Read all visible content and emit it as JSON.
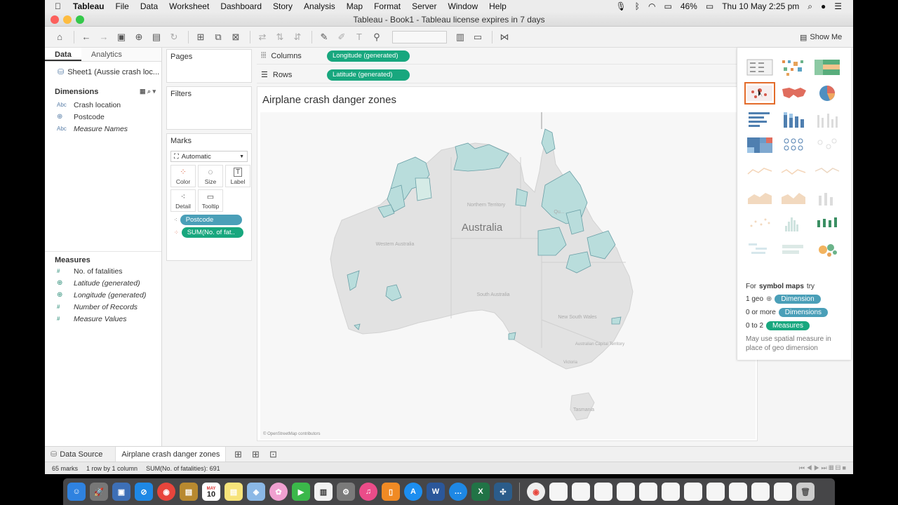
{
  "menubar": {
    "app": "Tableau",
    "items": [
      "File",
      "Data",
      "Worksheet",
      "Dashboard",
      "Story",
      "Analysis",
      "Map",
      "Format",
      "Server",
      "Window",
      "Help"
    ],
    "battery": "46%",
    "datetime": "Thu 10 May  2:25 pm"
  },
  "window": {
    "title": "Tableau - Book1 - Tableau license expires in 7 days"
  },
  "toolbar": {
    "show_me": "Show Me"
  },
  "datapane": {
    "tab_data": "Data",
    "tab_analytics": "Analytics",
    "source": "Sheet1 (Aussie crash loc...",
    "dimensions_header": "Dimensions",
    "dimensions": [
      {
        "type": "Abc",
        "label": "Crash location",
        "italic": false
      },
      {
        "type": "geo",
        "label": "Postcode",
        "italic": false
      },
      {
        "type": "Abc",
        "label": "Measure Names",
        "italic": true
      }
    ],
    "measures_header": "Measures",
    "measures": [
      {
        "type": "#",
        "label": "No. of fatalities",
        "italic": false
      },
      {
        "type": "geo",
        "label": "Latitude (generated)",
        "italic": true
      },
      {
        "type": "geo",
        "label": "Longitude (generated)",
        "italic": true
      },
      {
        "type": "#",
        "label": "Number of Records",
        "italic": true
      },
      {
        "type": "#",
        "label": "Measure Values",
        "italic": true
      }
    ]
  },
  "shelves": {
    "pages": "Pages",
    "filters": "Filters",
    "marks": "Marks",
    "mark_type": "Automatic",
    "buttons": [
      "Color",
      "Size",
      "Label",
      "Detail",
      "Tooltip"
    ],
    "pills": [
      {
        "label": "Postcode",
        "color": "#4a9fb8"
      },
      {
        "label": "SUM(No. of fat..",
        "color": "#18a77e"
      }
    ]
  },
  "columns": {
    "label": "Columns",
    "pill": "Longitude (generated)"
  },
  "rows": {
    "label": "Rows",
    "pill": "Latitude (generated)"
  },
  "view": {
    "title": "Airplane crash danger zones",
    "map_labels": {
      "country": "Australia",
      "wa": "Western Australia",
      "nt": "Northern Territory",
      "sa": "South Australia",
      "nsw": "New South Wales",
      "qld": "Qu...",
      "act": "Australian Capital Territory",
      "vic": "Victoria",
      "tas": "Tasmania"
    },
    "attribution": "© OpenStreetMap contributors"
  },
  "showme": {
    "selected": "symbol-maps",
    "hint_intro_prefix": "For",
    "hint_intro_bold": "symbol maps",
    "hint_intro_suffix": "try",
    "req1_count": "1 geo",
    "req1_chip": "Dimension",
    "req2_count": "0 or more",
    "req2_chip": "Dimensions",
    "req3_count": "0 to 2",
    "req3_chip": "Measures",
    "note": "May use spatial measure in place of geo dimension",
    "colors": {
      "dimension": "#4a9fb8",
      "measure": "#18a77e",
      "selected": "#e36b2a"
    }
  },
  "tabs": {
    "data_source": "Data Source",
    "sheet": "Airplane crash danger zones"
  },
  "status": {
    "marks": "65 marks",
    "rows_cols": "1 row by 1 column",
    "sum": "SUM(No. of fatalities): 691"
  },
  "dock": {
    "calendar_day": "10",
    "calendar_month": "MAY"
  }
}
